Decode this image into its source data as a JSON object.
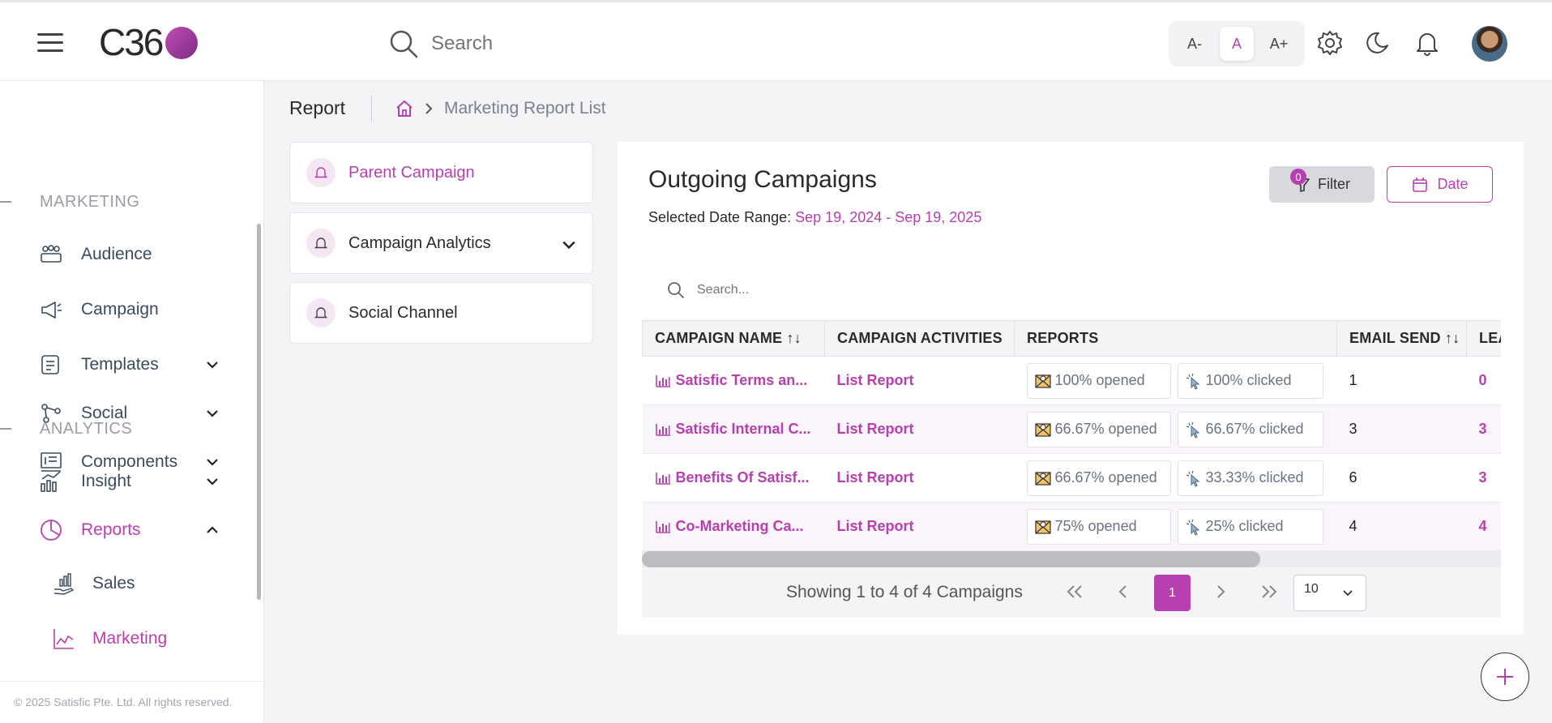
{
  "header": {
    "logo_text": "C36",
    "search_placeholder": "Search",
    "font_decrease": "A-",
    "font_normal": "A",
    "font_increase": "A+"
  },
  "sidebar": {
    "section_marketing": "MARKETING",
    "section_analytics": "ANALYTICS",
    "items": {
      "audience": "Audience",
      "campaign": "Campaign",
      "templates": "Templates",
      "social": "Social",
      "components": "Components",
      "insight": "Insight",
      "reports": "Reports",
      "sales": "Sales",
      "marketing": "Marketing"
    },
    "copyright": "© 2025 Satisfic Pte. Ltd. All rights reserved."
  },
  "breadcrumb": {
    "title": "Report",
    "current": "Marketing Report List"
  },
  "nav_cards": [
    {
      "label": "Parent Campaign",
      "active": true
    },
    {
      "label": "Campaign Analytics",
      "active": false
    },
    {
      "label": "Social Channel",
      "active": false
    }
  ],
  "panel": {
    "title": "Outgoing Campaigns",
    "date_range_label": "Selected Date Range:",
    "date_range_value": "Sep 19, 2024 - Sep 19, 2025",
    "filter_label": "Filter",
    "filter_count": "0",
    "date_label": "Date",
    "search_placeholder": "Search..."
  },
  "table": {
    "columns": [
      "CAMPAIGN NAME ↑↓",
      "CAMPAIGN ACTIVITIES",
      "REPORTS",
      "EMAIL SEND ↑↓",
      "LEA"
    ],
    "rows": [
      {
        "name": "Satisfic Terms an...",
        "activity": "List Report",
        "opened": "100% opened",
        "clicked": "100% clicked",
        "email_send": "1",
        "leads": "0"
      },
      {
        "name": "Satisfic Internal C...",
        "activity": "List Report",
        "opened": "66.67% opened",
        "clicked": "66.67% clicked",
        "email_send": "3",
        "leads": "3"
      },
      {
        "name": "Benefits Of Satisf...",
        "activity": "List Report",
        "opened": "66.67% opened",
        "clicked": "33.33% clicked",
        "email_send": "6",
        "leads": "3"
      },
      {
        "name": "Co-Marketing Ca...",
        "activity": "List Report",
        "opened": "75% opened",
        "clicked": "25% clicked",
        "email_send": "4",
        "leads": "4"
      }
    ]
  },
  "pagination": {
    "summary": "Showing 1 to 4 of 4 Campaigns",
    "current_page": "1",
    "page_size": "10"
  },
  "colors": {
    "accent": "#b83fb0",
    "text_primary": "#2a2a2a",
    "text_muted": "#7b8190"
  }
}
